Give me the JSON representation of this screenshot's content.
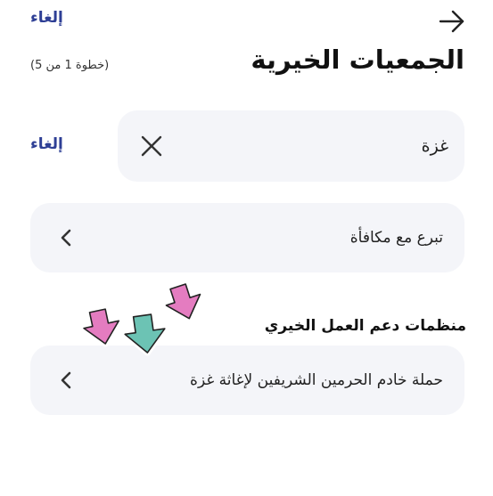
{
  "header": {
    "cancel_label": "إلغاء",
    "back_icon": "arrow-right-icon"
  },
  "title": {
    "text": "الجمعيات الخيرية",
    "step": "(خطوة 1 من 5)"
  },
  "search": {
    "value": "غزة",
    "clear_icon": "close-icon",
    "cancel_label": "إلغاء"
  },
  "rows": [
    {
      "label": "تبرع مع مكافأة",
      "icon": "chevron-left-icon"
    }
  ],
  "section": {
    "heading": "منظمات دعم العمل الخيري",
    "items": [
      {
        "label": "حملة خادم الحرمين الشريفين لإغاثة غزة",
        "icon": "chevron-left-icon"
      }
    ]
  },
  "colors": {
    "accent": "#2e3f95",
    "row_bg": "#f4f5f9",
    "sticker_pink": "#e47cc0",
    "sticker_teal": "#6cc3b4"
  }
}
